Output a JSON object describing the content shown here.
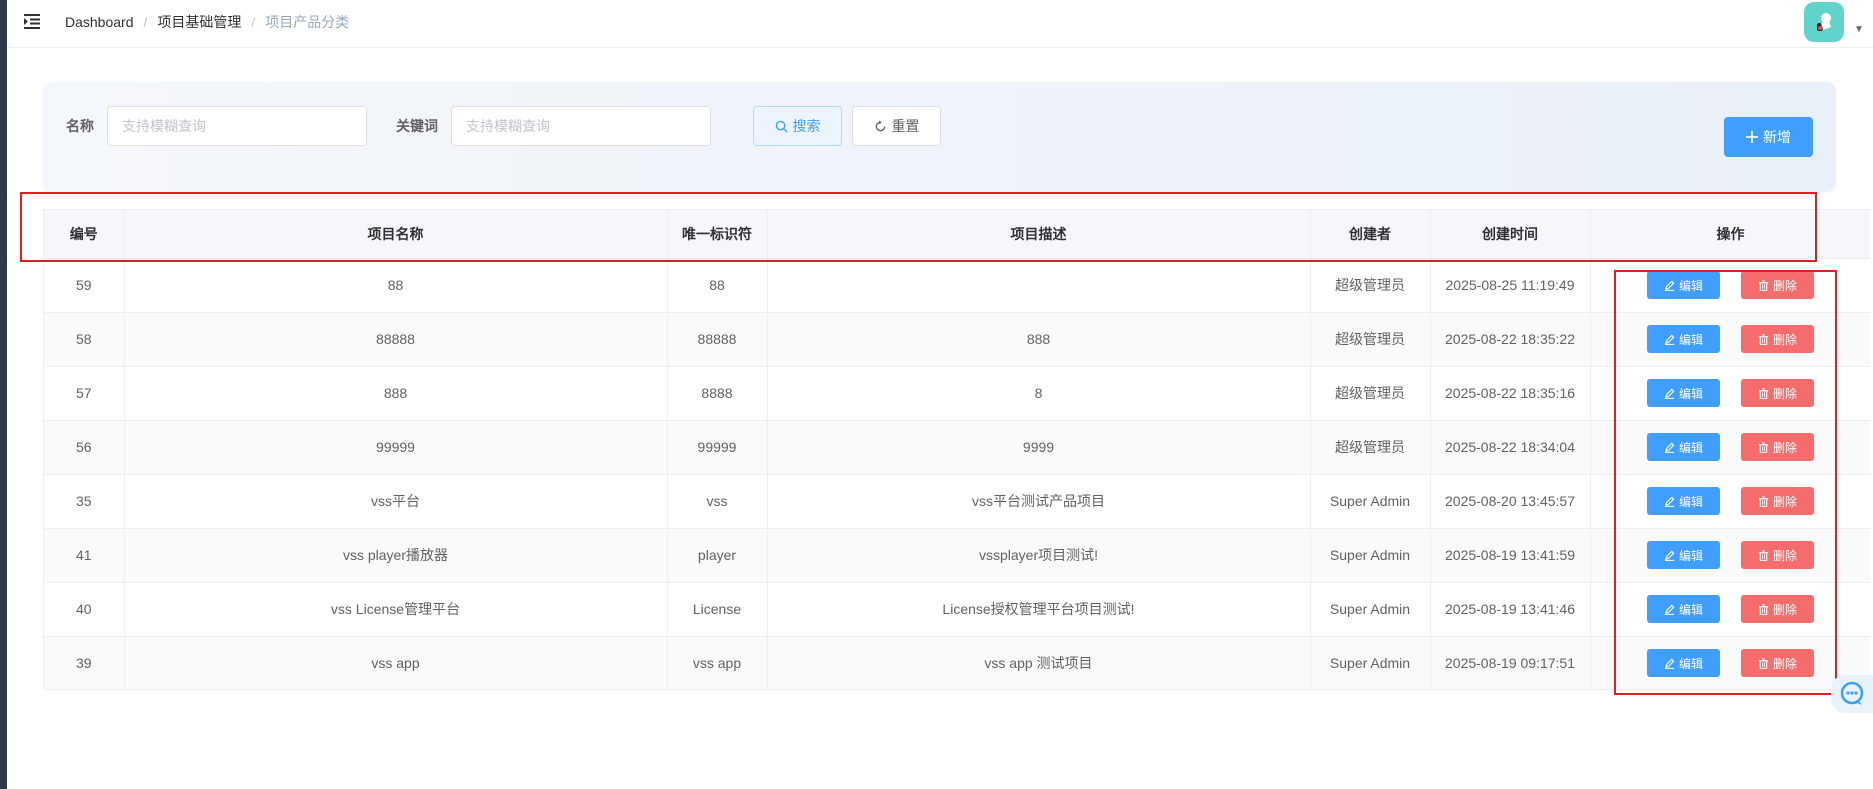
{
  "breadcrumb": {
    "items": [
      "Dashboard",
      "项目基础管理",
      "项目产品分类"
    ],
    "separator": "/"
  },
  "filters": {
    "name_label": "名称",
    "name_placeholder": "支持模糊查询",
    "keyword_label": "关键词",
    "keyword_placeholder": "支持模糊查询",
    "search_label": "搜索",
    "reset_label": "重置",
    "add_label": "新增"
  },
  "table": {
    "headers": [
      "编号",
      "项目名称",
      "唯一标识符",
      "项目描述",
      "创建者",
      "创建时间",
      "操作"
    ],
    "edit_label": "编辑",
    "delete_label": "删除",
    "rows": [
      {
        "id": "59",
        "name": "88",
        "key": "88",
        "desc": "",
        "creator": "超级管理员",
        "created": "2025-08-25 11:19:49"
      },
      {
        "id": "58",
        "name": "88888",
        "key": "88888",
        "desc": "888",
        "creator": "超级管理员",
        "created": "2025-08-22 18:35:22"
      },
      {
        "id": "57",
        "name": "888",
        "key": "8888",
        "desc": "8",
        "creator": "超级管理员",
        "created": "2025-08-22 18:35:16"
      },
      {
        "id": "56",
        "name": "99999",
        "key": "99999",
        "desc": "9999",
        "creator": "超级管理员",
        "created": "2025-08-22 18:34:04"
      },
      {
        "id": "35",
        "name": "vss平台",
        "key": "vss",
        "desc": "vss平台测试产品项目",
        "creator": "Super Admin",
        "created": "2025-08-20 13:45:57"
      },
      {
        "id": "41",
        "name": "vss player播放器",
        "key": "player",
        "desc": "vssplayer项目测试!",
        "creator": "Super Admin",
        "created": "2025-08-19 13:41:59"
      },
      {
        "id": "40",
        "name": "vss License管理平台",
        "key": "License",
        "desc": "License授权管理平台项目测试!",
        "creator": "Super Admin",
        "created": "2025-08-19 13:41:46"
      },
      {
        "id": "39",
        "name": "vss app",
        "key": "vss app",
        "desc": "vss app 测试项目",
        "creator": "Super Admin",
        "created": "2025-08-19 09:17:51"
      }
    ]
  },
  "colors": {
    "primary": "#409eff",
    "danger": "#f56c6c",
    "annotation": "#e02020"
  },
  "icons": {
    "menu": "menu-fold-icon",
    "search": "search-icon",
    "reset": "refresh-icon",
    "add": "plus-icon",
    "edit": "edit-icon",
    "delete": "trash-icon",
    "chat": "chat-bubble-icon",
    "avatar": "avatar-image",
    "caret": "caret-down-icon"
  }
}
